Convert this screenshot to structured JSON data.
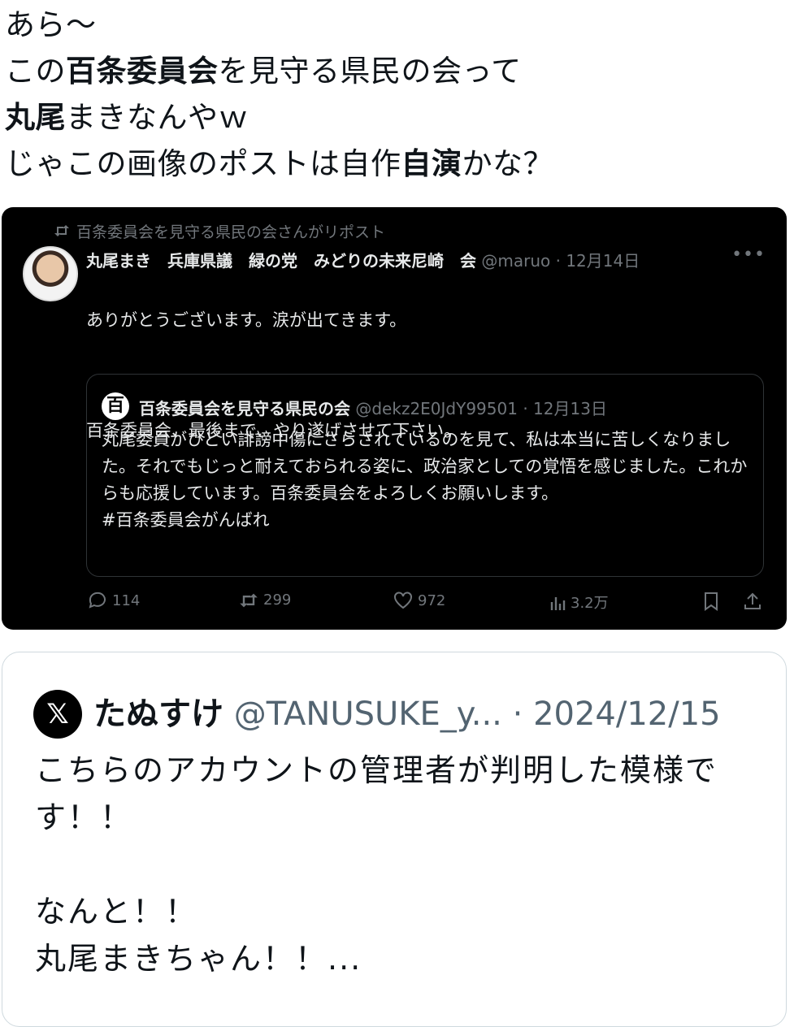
{
  "top_text": [
    [
      "あら〜"
    ],
    [
      "この",
      "百条委員会",
      "を見守る県民の会って"
    ],
    [
      "丸尾",
      "まきなんやｗ"
    ],
    [
      "じゃこの画像のポストは自作",
      "自演",
      "かな？"
    ]
  ],
  "screenshot": {
    "repost_label": "百条委員会を見守る県民の会さんがリポスト",
    "author": "丸尾まき　兵庫県議　緑の党　みどりの未来尼崎　会",
    "handle": "@maruo",
    "date": "12月14日",
    "post_lines": [
      "ありがとうございます。涙が出てきます。",
      "",
      "百条委員会、最後まで、やり遂げさせて下さい。"
    ],
    "quote": {
      "icon_char": "百",
      "name": "百条委員会を見守る県民の会",
      "handle": "@dekz2E0JdY99501",
      "date": "12月13日",
      "text": "丸尾委員がひどい誹謗中傷にさらされているのを見て、私は本当に苦しくなりました。それでもじっと耐えておられる姿に、政治家としての覚悟を感じました。これからも応援しています。百条委員会をよろしくお願いします。",
      "hashtag": "#百条委員会がんばれ"
    },
    "stats": {
      "replies": "114",
      "reposts": "299",
      "likes": "972",
      "views": "3.2万"
    }
  },
  "card": {
    "logo": "𝕏",
    "name": "たぬすけ",
    "handle": "@TANUSUKE_y...",
    "date": "2024/12/15",
    "lines": [
      "こちらのアカウントの管理者が判明した模様で",
      "す！！",
      "",
      "なんと！！",
      "丸尾まきちゃん！！..."
    ]
  }
}
